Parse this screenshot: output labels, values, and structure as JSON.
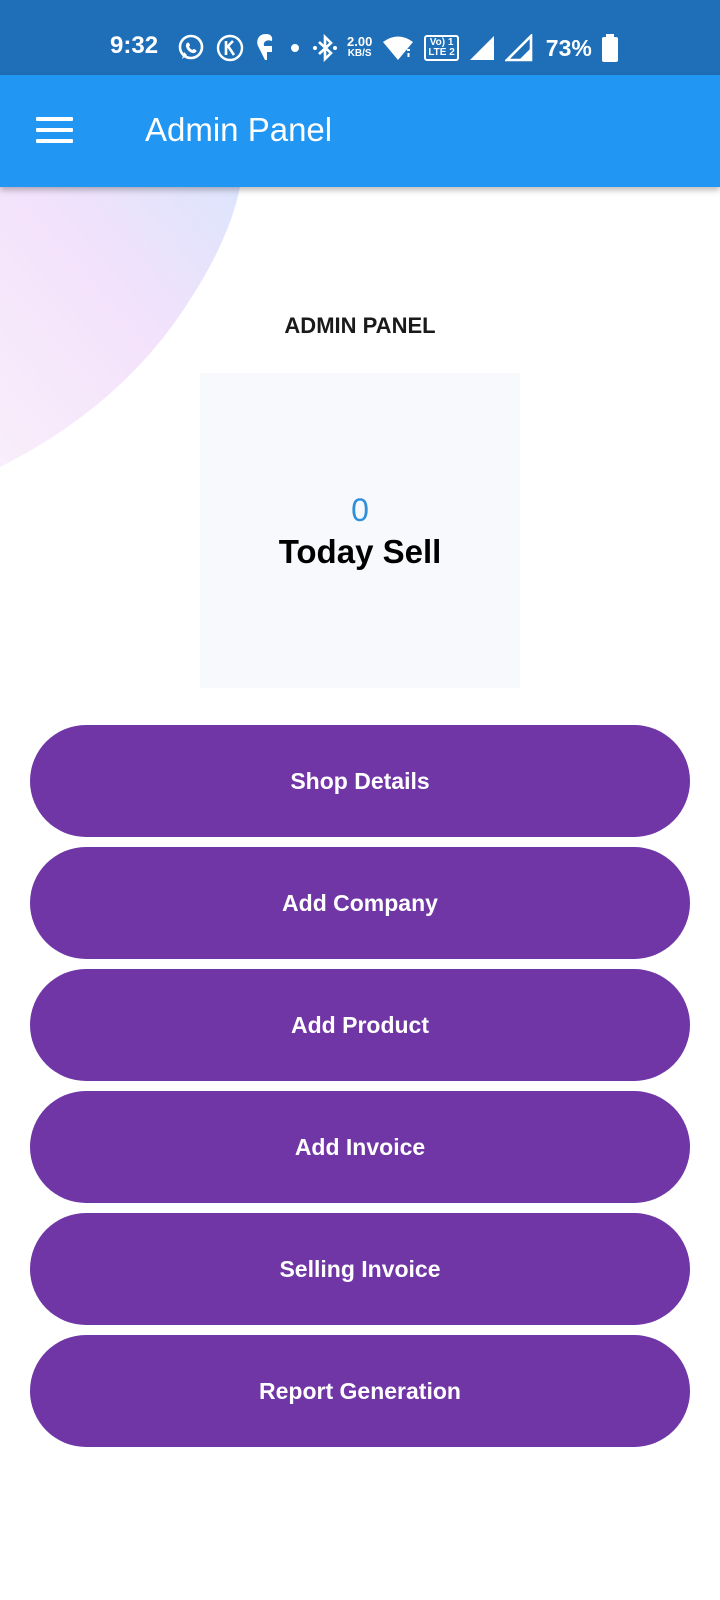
{
  "status_bar": {
    "time": "9:32",
    "net_speed_value": "2.00",
    "net_speed_unit": "KB/S",
    "lte_top": "Vo) 1",
    "lte_bottom": "LTE 2",
    "battery": "73%",
    "colors": {
      "background": "#1e6fb8",
      "foreground": "#ffffff"
    },
    "icons": [
      "whatsapp-icon",
      "k-app-icon",
      "swiggy-icon",
      "notification-dot-icon",
      "bluetooth-icon",
      "wifi-icon",
      "signal-icon",
      "signal-icon",
      "battery-icon"
    ]
  },
  "app_bar": {
    "title": "Admin Panel",
    "menu_icon": "hamburger-menu-icon",
    "color": "#2196f3"
  },
  "main": {
    "section_title": "ADMIN PANEL",
    "today_sell": {
      "value": "0",
      "label": "Today Sell",
      "value_color": "#2f8fd8"
    },
    "buttons": [
      {
        "label": "Shop Details"
      },
      {
        "label": "Add Company"
      },
      {
        "label": "Add Product"
      },
      {
        "label": "Add Invoice"
      },
      {
        "label": "Selling Invoice"
      },
      {
        "label": "Report Generation"
      }
    ],
    "button_color": "#7036a6"
  }
}
